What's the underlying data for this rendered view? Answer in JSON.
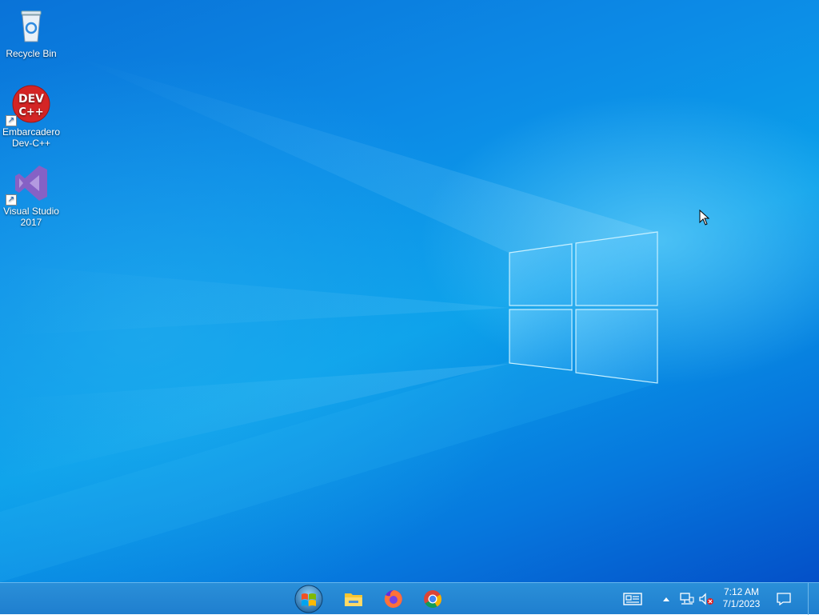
{
  "desktop": {
    "icons": [
      {
        "label_line1": "Recycle Bin",
        "label_line2": "",
        "icon": "recycle-bin-icon"
      },
      {
        "label_line1": "Embarcadero",
        "label_line2": "Dev-C++",
        "icon": "dev-cpp-icon",
        "glyph_text_1": "DEV",
        "glyph_text_2": "C++"
      },
      {
        "label_line1": "Visual Studio",
        "label_line2": "2017",
        "icon": "visual-studio-icon"
      }
    ],
    "wallpaper": "windows-10-hero",
    "colors": {
      "wallpaper_main": "#0a8ae6",
      "taskbar": "#2384d3"
    }
  },
  "taskbar": {
    "start_icon": "start-orb-icon",
    "pinned_apps": [
      {
        "name": "file-explorer-icon"
      },
      {
        "name": "firefox-icon"
      },
      {
        "name": "chrome-icon"
      }
    ],
    "tray": {
      "news_icon": "news-widget-icon",
      "overflow_icon": "chevron-up-icon",
      "network_icon": "network-icon",
      "volume_icon": "volume-muted-icon",
      "notification_icon": "action-center-icon"
    },
    "clock": {
      "time": "7:12 AM",
      "date": "7/1/2023"
    }
  }
}
